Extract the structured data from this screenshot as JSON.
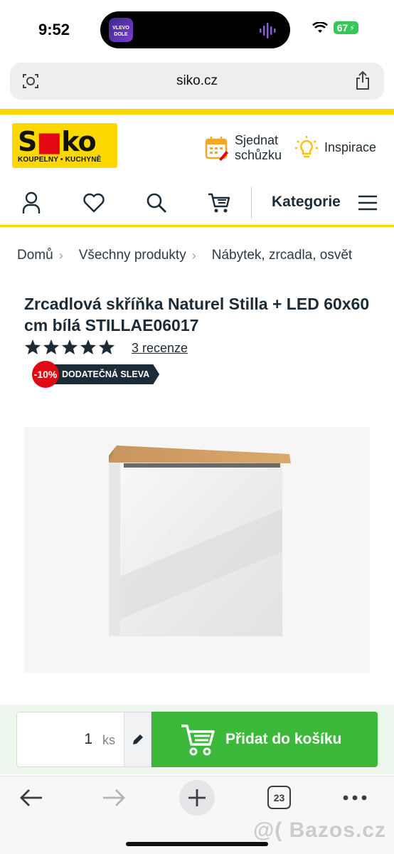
{
  "status": {
    "time": "9:52",
    "battery": "67",
    "island_app_text": "VLEVO DOLE"
  },
  "browser": {
    "url": "siko.cz",
    "tabs_count": "23"
  },
  "header": {
    "logo_word_a": "S",
    "logo_word_b": "ko",
    "logo_sub": "KOUPELNY • KUCHYNĚ",
    "schedule_line1": "Sjednat",
    "schedule_line2": "schůzku",
    "inspiration": "Inspirace"
  },
  "nav": {
    "categories": "Kategorie"
  },
  "breadcrumb": [
    "Domů",
    "Všechny produkty",
    "Nábytek, zrcadla, osvět"
  ],
  "product": {
    "title": "Zrcadlová skříňka Naturel Stilla + LED 60x60 cm bílá STILLAE06017",
    "rating": 5,
    "reviews": "3 recenze",
    "badge_percent": "-10%",
    "badge_label": "DODATEČNÁ SLEVA"
  },
  "cart": {
    "qty": "1",
    "unit": "ks",
    "add_label": "Přidat do košíku"
  },
  "watermark": "@( Bazos.cz",
  "colors": {
    "brand_yellow": "#fcd800",
    "cta_green": "#3cb93b",
    "badge_red": "#e30613",
    "text_dark": "#1d2b36"
  }
}
